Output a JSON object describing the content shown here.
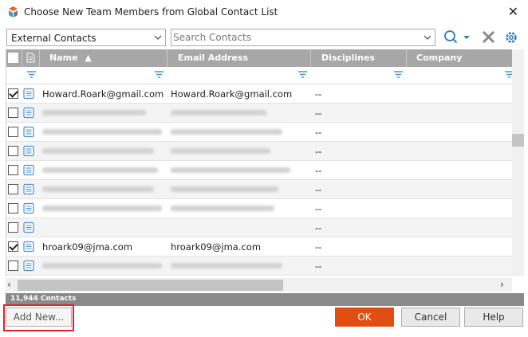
{
  "window": {
    "title": "Choose New Team Members from Global Contact List",
    "close_glyph": "✕"
  },
  "toolbar": {
    "contact_source": "External Contacts",
    "search_placeholder": "Search Contacts"
  },
  "grid": {
    "columns": [
      "Name",
      "Email Address",
      "Disciplines",
      "Company"
    ],
    "sort_indicator": "▲",
    "rows": [
      {
        "checked": true,
        "name": "Howard.Roark@gmail.com",
        "email": "Howard.Roark@gmail.com",
        "disciplines": "--"
      },
      {
        "checked": false,
        "name": "",
        "email": "",
        "disciplines": "--"
      },
      {
        "checked": false,
        "name": "",
        "email": "",
        "disciplines": "--"
      },
      {
        "checked": false,
        "name": "",
        "email": "",
        "disciplines": "--"
      },
      {
        "checked": false,
        "name": "",
        "email": "",
        "disciplines": "--"
      },
      {
        "checked": false,
        "name": "",
        "email": "",
        "disciplines": "--"
      },
      {
        "checked": false,
        "name": "",
        "email": "",
        "disciplines": "--"
      },
      {
        "checked": false,
        "name": "",
        "email": "",
        "disciplines": "--"
      },
      {
        "checked": true,
        "name": "hroark09@jma.com",
        "email": "hroark09@jma.com",
        "disciplines": "--"
      },
      {
        "checked": false,
        "name": "",
        "email": "",
        "disciplines": "--"
      },
      {
        "checked": false,
        "name": "",
        "email": "",
        "disciplines": ""
      }
    ]
  },
  "status": {
    "count": "11,944 Contacts"
  },
  "buttons": {
    "add_new": "Add New...",
    "ok": "OK",
    "cancel": "Cancel",
    "help": "Help"
  },
  "colors": {
    "header": "#a7a7a7",
    "ok_button": "#e04e12",
    "highlight": "#e0232a"
  },
  "icons": [
    "app-logo-icon",
    "close-icon",
    "chevron-down-icon",
    "search-icon",
    "clear-icon",
    "gear-icon",
    "filter-icon",
    "contact-card-icon"
  ]
}
